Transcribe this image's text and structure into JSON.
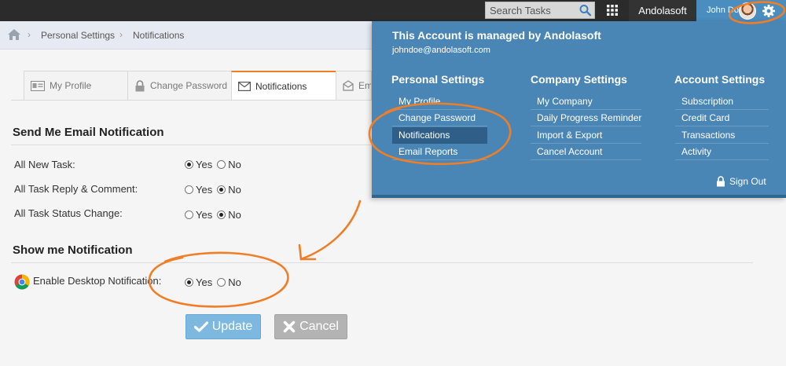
{
  "topbar": {
    "search_placeholder": "Search Tasks",
    "org_name": "Andolasoft",
    "user_name": "John Doe",
    "icons": {
      "search": "search-icon",
      "apps": "apps-grid-icon",
      "settings": "gear-icon"
    }
  },
  "breadcrumb": {
    "items": [
      "Personal Settings",
      "Notifications"
    ]
  },
  "tabs": [
    {
      "label": "My Profile",
      "icon": "id-card-icon"
    },
    {
      "label": "Change Password",
      "icon": "lock-icon"
    },
    {
      "label": "Notifications",
      "icon": "envelope-icon"
    },
    {
      "label": "Email Reports",
      "icon": "email-report-icon"
    }
  ],
  "email_notifications": {
    "title": "Send Me Email Notification",
    "rows": [
      {
        "label": "All New Task:",
        "yes": "Yes",
        "no": "No",
        "selected": "yes"
      },
      {
        "label": "All Task Reply & Comment:",
        "yes": "Yes",
        "no": "No",
        "selected": "no"
      },
      {
        "label": "All Task Status Change:",
        "yes": "Yes",
        "no": "No",
        "selected": "no"
      }
    ]
  },
  "show_notification": {
    "title": "Show me Notification",
    "desktop": {
      "label": "Enable Desktop Notification:",
      "yes": "Yes",
      "no": "No",
      "selected": "yes"
    }
  },
  "actions": {
    "update": "Update",
    "cancel": "Cancel"
  },
  "menu": {
    "title": "This Account is managed by Andolasoft",
    "email": "johndoe@andolasoft.com",
    "columns": [
      {
        "heading": "Personal Settings",
        "items": [
          "My Profile",
          "Change Password",
          "Notifications",
          "Email Reports"
        ],
        "active": "Notifications"
      },
      {
        "heading": "Company Settings",
        "items": [
          "My Company",
          "Daily Progress Reminder",
          "Import & Export",
          "Cancel Account"
        ]
      },
      {
        "heading": "Account Settings",
        "items": [
          "Subscription",
          "Credit Card",
          "Transactions",
          "Activity"
        ]
      }
    ],
    "sign_out": "Sign Out"
  },
  "colors": {
    "accent": "#4a86b5",
    "topbar": "#2b2b2b",
    "annotation": "#f07e26",
    "update_button": "#7db8e0",
    "cancel_button": "#b3b3b3"
  }
}
